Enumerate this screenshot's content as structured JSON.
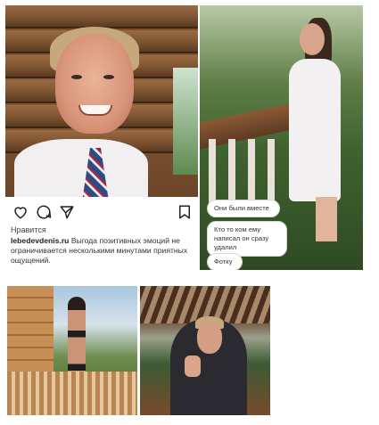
{
  "post": {
    "likes_label": "Нравится",
    "username": "lebedevdenis.ru",
    "caption": " Выгода позитивных эмоций не ограничивается несколькими минутами приятных ощущений.",
    "icons": [
      "heart-icon",
      "comment-icon",
      "share-icon",
      "bookmark-icon"
    ]
  },
  "chat": {
    "messages": [
      "Они были вместе",
      "Кто то ком ему написал он сразу удалил",
      "Фотку"
    ]
  }
}
